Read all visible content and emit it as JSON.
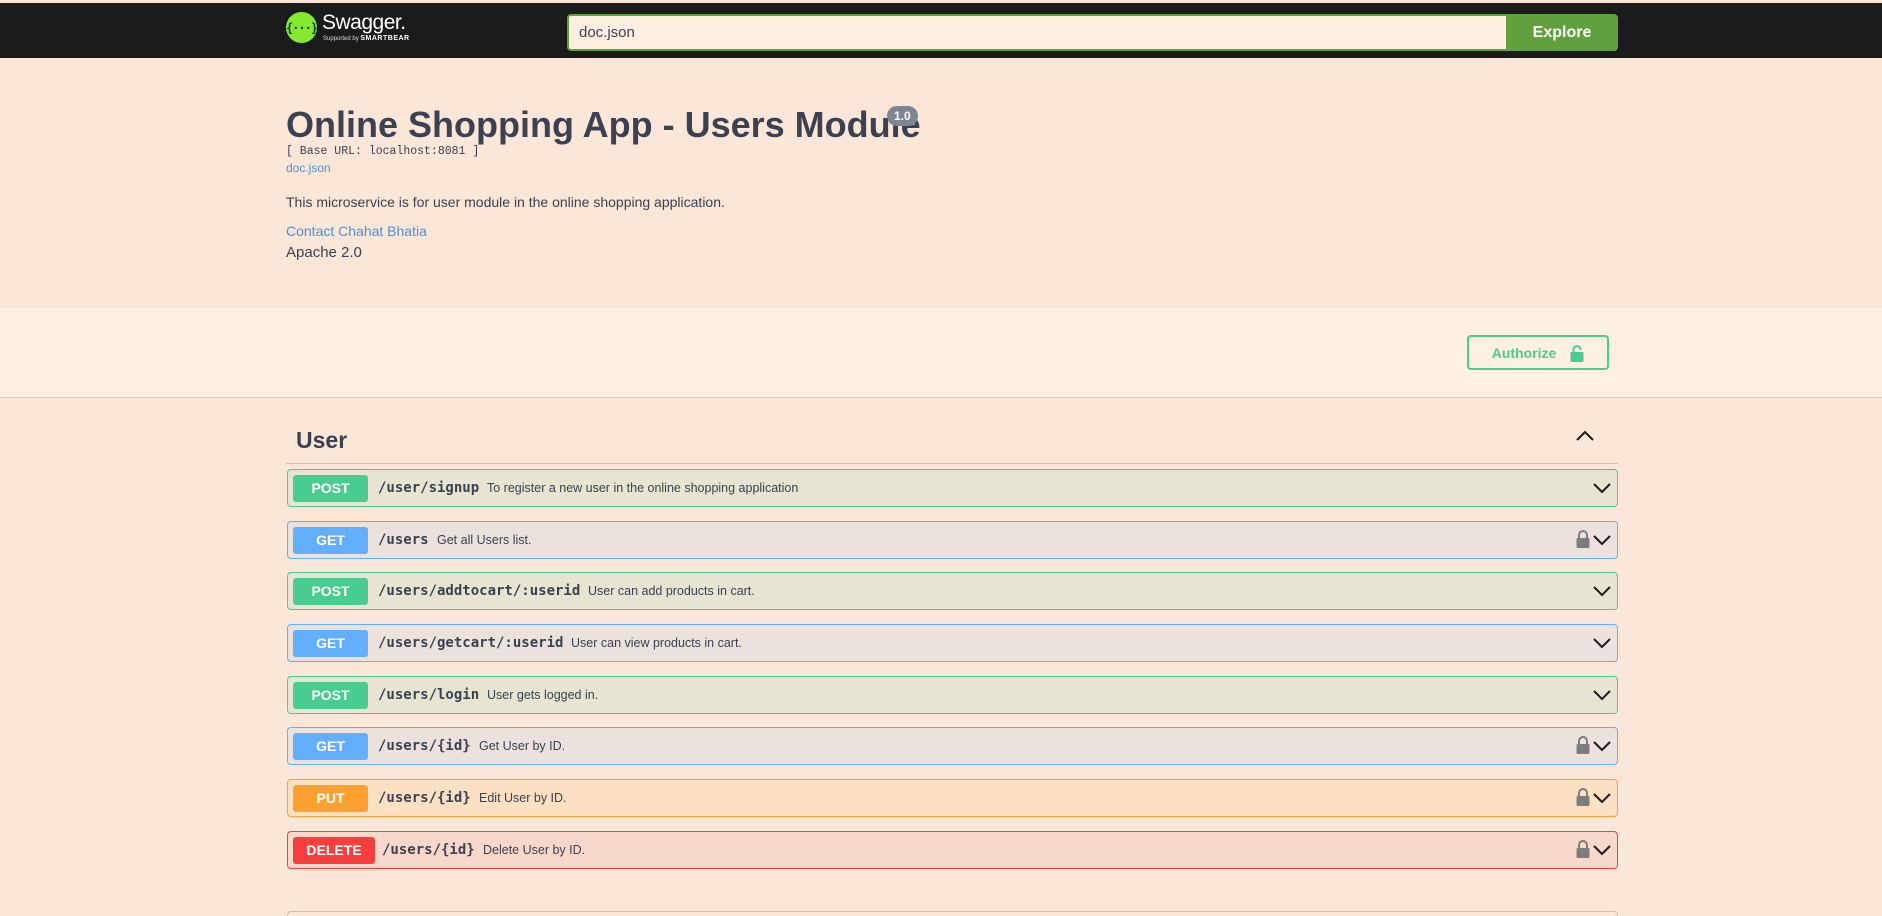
{
  "topbar": {
    "logo_name": "Swagger.",
    "logo_supported": "Supported by",
    "logo_brand": "SMARTBEAR",
    "search_value": "doc.json",
    "explore_label": "Explore"
  },
  "info": {
    "title": "Online Shopping App - Users Module",
    "version": "1.0",
    "base_url": "[ Base URL: localhost:8081 ]",
    "doc_link": "doc.json",
    "description": "This microservice is for user module in the online shopping application.",
    "contact": "Contact Chahat Bhatia",
    "license": "Apache 2.0"
  },
  "authorize_label": "Authorize",
  "tag": {
    "name": "User"
  },
  "operations": [
    {
      "method": "POST",
      "path": "/user/signup",
      "summary": "To register a new user in the online shopping application",
      "locked": false
    },
    {
      "method": "GET",
      "path": "/users",
      "summary": "Get all Users list.",
      "locked": true
    },
    {
      "method": "POST",
      "path": "/users/addtocart/:userid",
      "summary": "User can add products in cart.",
      "locked": false
    },
    {
      "method": "GET",
      "path": "/users/getcart/:userid",
      "summary": "User can view products in cart.",
      "locked": false
    },
    {
      "method": "POST",
      "path": "/users/login",
      "summary": "User gets logged in.",
      "locked": false
    },
    {
      "method": "GET",
      "path": "/users/{id}",
      "summary": "Get User by ID.",
      "locked": true
    },
    {
      "method": "PUT",
      "path": "/users/{id}",
      "summary": "Edit User by ID.",
      "locked": true
    },
    {
      "method": "DELETE",
      "path": "/users/{id}",
      "summary": "Delete User by ID.",
      "locked": true
    }
  ],
  "colors": {
    "post": "#49cc90",
    "get": "#61affe",
    "put": "#fca130",
    "delete": "#f93e3e",
    "explore": "#62a03f"
  }
}
